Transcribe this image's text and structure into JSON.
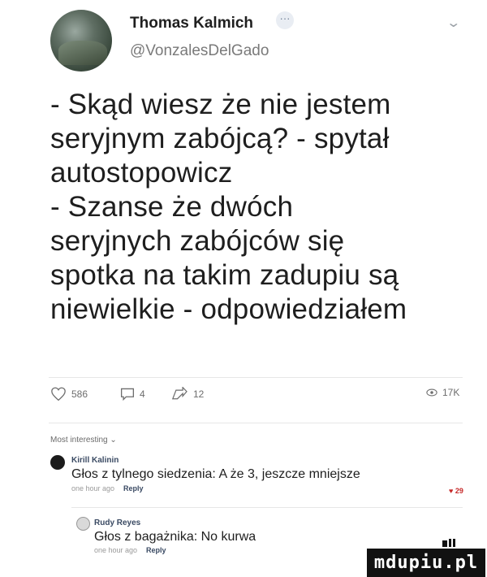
{
  "post": {
    "author_name": "Thomas Kalmich",
    "more_badge": "···",
    "handle": "@VonzalesDelGado",
    "text": "- Skąd wiesz że nie jestem\nseryjnym zabójcą? - spytał\nautostopowicz\n- Szanse że dwóch\nseryjnych zabójców się\nspotka na takim zadupiu są\nniewielkie - odpowiedziałem",
    "likes": "586",
    "comments": "4",
    "shares": "12",
    "views": "17K"
  },
  "comments_section": {
    "sort_label": "Most interesting ⌄",
    "comments": [
      {
        "author": "Kirill Kalinin",
        "text": "Głos z tylnego siedzenia: A że 3, jeszcze mniejsze",
        "time": "one hour ago",
        "reply_label": "Reply",
        "likes": "29"
      },
      {
        "author": "Rudy Reyes",
        "text": "Głos z bagażnika: No kurwa",
        "time": "one hour ago",
        "reply_label": "Reply"
      }
    ]
  },
  "watermark": "mdupiu.pl",
  "colors": {
    "accent_like": "#c62828",
    "text": "#1e1e1e",
    "muted": "#7a7a7a"
  },
  "icons": {
    "like": "heart-outline-icon",
    "comment": "speech-bubble-icon",
    "share": "share-arrow-icon",
    "views": "eye-icon",
    "more": "chevron-down-icon"
  }
}
